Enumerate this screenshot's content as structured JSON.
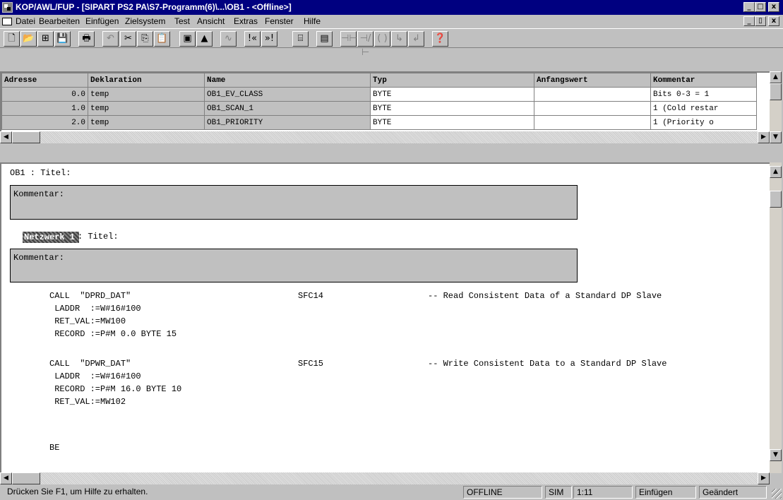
{
  "window": {
    "title": "KOP/AWL/FUP  - [SIPART PS2 PA\\S7-Programm(6)\\...\\OB1 - <Offline>]"
  },
  "window_buttons": {
    "minimize": "_",
    "maximize": "□",
    "close": "x"
  },
  "doc_buttons": {
    "minimize": "_",
    "restore": "▯",
    "close": "x"
  },
  "menu": [
    "Datei",
    "Bearbeiten",
    "Einfügen",
    "Zielsystem",
    "Test",
    "Ansicht",
    "Extras",
    "Fenster",
    "Hilfe"
  ],
  "toolbar": {
    "icons": [
      "new-icon",
      "open-icon",
      "accessible-nodes-icon",
      "save-icon",
      "print-icon",
      "undo-icon",
      "cut-icon",
      "copy-icon",
      "paste-icon",
      "load-icon",
      "download-icon",
      "monitor-icon",
      "prev-network-icon",
      "next-network-icon",
      "overview-icon",
      "program-elements-icon",
      "contact-no-icon",
      "contact-nc-icon",
      "coil-icon",
      "branch-open-icon",
      "branch-close-icon",
      "help-icon"
    ],
    "glyphs": [
      "🗋",
      "📂",
      "⊞",
      "💾",
      "🖶",
      "↶",
      "✂",
      "⎘",
      "📋",
      "▣",
      "▲",
      "∿",
      "!«",
      "»!",
      "⌸",
      "▤",
      "⊣⊢",
      "⊣/⊢",
      "( )",
      "↳",
      "↲",
      "❓"
    ]
  },
  "declaration_table": {
    "columns": [
      "Adresse",
      "Deklaration",
      "Name",
      "Typ",
      "Anfangswert",
      "Kommentar"
    ],
    "rows": [
      {
        "address": "0.0",
        "decl": "temp",
        "name": "OB1_EV_CLASS",
        "type": "BYTE",
        "init": "",
        "comment": "Bits 0-3 = 1"
      },
      {
        "address": "1.0",
        "decl": "temp",
        "name": "OB1_SCAN_1",
        "type": "BYTE",
        "init": "",
        "comment": "1 (Cold restar"
      },
      {
        "address": "2.0",
        "decl": "temp",
        "name": "OB1_PRIORITY",
        "type": "BYTE",
        "init": "",
        "comment": "1 (Priority o"
      }
    ]
  },
  "editor": {
    "block_title": "OB1 : Titel:",
    "block_comment_label": "Kommentar:",
    "network_label": "Netzwerk 1",
    "network_title": ": Titel:",
    "network_comment_label": "Kommentar:",
    "code_lines": [
      {
        "text": "CALL  \"DPRD_DAT\"",
        "block": "SFC14",
        "comment": "-- Read Consistent Data of a Standard DP Slave"
      },
      {
        "text": " LADDR  :=W#16#100"
      },
      {
        "text": " RET_VAL:=MW100"
      },
      {
        "text": " RECORD :=P#M 0.0 BYTE 15"
      },
      {
        "text": ""
      },
      {
        "text": "CALL  \"DPWR_DAT\"",
        "block": "SFC15",
        "comment": "-- Write Consistent Data to a Standard DP Slave"
      },
      {
        "text": " LADDR  :=W#16#100"
      },
      {
        "text": " RECORD :=P#M 16.0 BYTE 10"
      },
      {
        "text": " RET_VAL:=MW102"
      }
    ],
    "end_statement": "BE"
  },
  "status": {
    "help": "Drücken Sie F1, um Hilfe zu erhalten.",
    "mode": "OFFLINE",
    "sim": "SIM",
    "position": "1:11",
    "insert": "Einfügen",
    "changed": "Geändert"
  }
}
